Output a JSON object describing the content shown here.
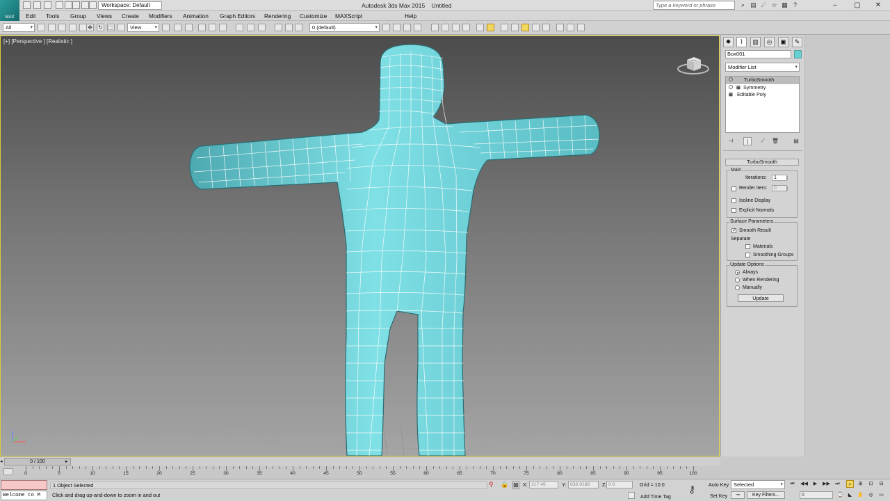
{
  "app": {
    "title": "Autodesk 3ds Max  2015",
    "document": "Untitled",
    "logo_text": "MAX",
    "workspace": "Workspace: Default",
    "search_placeholder": "Type a keyword or phrase"
  },
  "menu": [
    "Edit",
    "Tools",
    "Group",
    "Views",
    "Create",
    "Modifiers",
    "Animation",
    "Graph Editors",
    "Rendering",
    "Customize",
    "MAXScript",
    "Help"
  ],
  "toolbar": {
    "filter": "All",
    "ref_coord": "View",
    "layer": "0 (default)"
  },
  "viewport": {
    "label": "[+] [Perspective ] [Realistic ]",
    "viewcube_label": "LEFT",
    "mesh_color": "#66c9d1",
    "border_color": "#d8cc3a"
  },
  "command_panel": {
    "object_name": "Box001",
    "object_color": "#65d1d2",
    "modifier_list": "Modifier List",
    "stack": [
      {
        "name": "TurboSmooth",
        "selected": true
      },
      {
        "name": "Symmetry",
        "selected": false
      },
      {
        "name": "Editable Poly",
        "selected": false
      }
    ],
    "rollout_title": "TurboSmooth",
    "main_label": "Main",
    "iterations_label": "Iterations:",
    "iterations_value": "1",
    "render_iters_label": "Render Iters:",
    "render_iters_value": "0",
    "render_iters_checked": false,
    "isoline_label": "Isoline Display",
    "isoline_checked": false,
    "explicit_label": "Explicit Normals",
    "explicit_checked": false,
    "surface_params_label": "Surface Parameters",
    "smooth_result_label": "Smooth Result",
    "smooth_result_checked": true,
    "separate_label": "Separate",
    "materials_label": "Materials",
    "materials_checked": false,
    "smoothing_groups_label": "Smoothing Groups",
    "smoothing_groups_checked": false,
    "update_options_label": "Update Options",
    "always_label": "Always",
    "when_rendering_label": "When Rendering",
    "manually_label": "Manually",
    "update_mode": "Always",
    "update_button": "Update"
  },
  "timeline": {
    "frame": "0 / 100",
    "ticks": [
      0,
      5,
      10,
      15,
      20,
      25,
      30,
      35,
      40,
      45,
      50,
      55,
      60,
      65,
      70,
      75,
      80,
      85,
      90,
      95,
      100
    ]
  },
  "status": {
    "maxscript_text": "Welcome to M",
    "selection": "1 Object Selected",
    "prompt": "Click and drag up-and-down to zoom in and out",
    "x_label": "X:",
    "x_value": "217.45",
    "y_label": "Y:",
    "y_value": "633.9188",
    "z_label": "Z:",
    "z_value": "0.0",
    "grid": "Grid = 10.0",
    "add_time_tag": "Add Time Tag",
    "auto_key": "Auto Key",
    "auto_key_value": "Selected",
    "set_key": "Set Key",
    "key_filters": "Key Filters...",
    "current_frame": "0"
  }
}
